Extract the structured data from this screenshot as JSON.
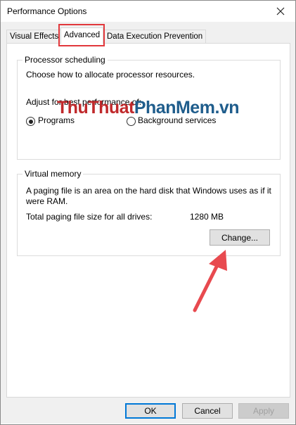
{
  "window": {
    "title": "Performance Options"
  },
  "tabs": [
    {
      "label": "Visual Effects"
    },
    {
      "label": "Advanced"
    },
    {
      "label": "Data Execution Prevention"
    }
  ],
  "processor": {
    "heading": "Processor scheduling",
    "description": "Choose how to allocate processor resources.",
    "adjust_label": "Adjust for best performance of:",
    "options": [
      {
        "label": "Programs",
        "selected": true
      },
      {
        "label": "Background services",
        "selected": false
      }
    ]
  },
  "watermark": {
    "part1": "ThuThuat",
    "part2": "PhanMem",
    "part3": ".vn"
  },
  "virtual_memory": {
    "heading": "Virtual memory",
    "description_line1": "A paging file is an area on the hard disk that Windows uses as if it",
    "description_line2": "were RAM.",
    "total_label": "Total paging file size for all drives:",
    "total_value": "1280 MB",
    "change_label": "Change..."
  },
  "footer": {
    "ok_label": "OK",
    "cancel_label": "Cancel",
    "apply_label": "Apply"
  },
  "colors": {
    "highlight": "#e2383c",
    "arrow": "#e84a4f",
    "watermark_red": "#c0292b",
    "watermark_blue": "#1f5d8c"
  }
}
